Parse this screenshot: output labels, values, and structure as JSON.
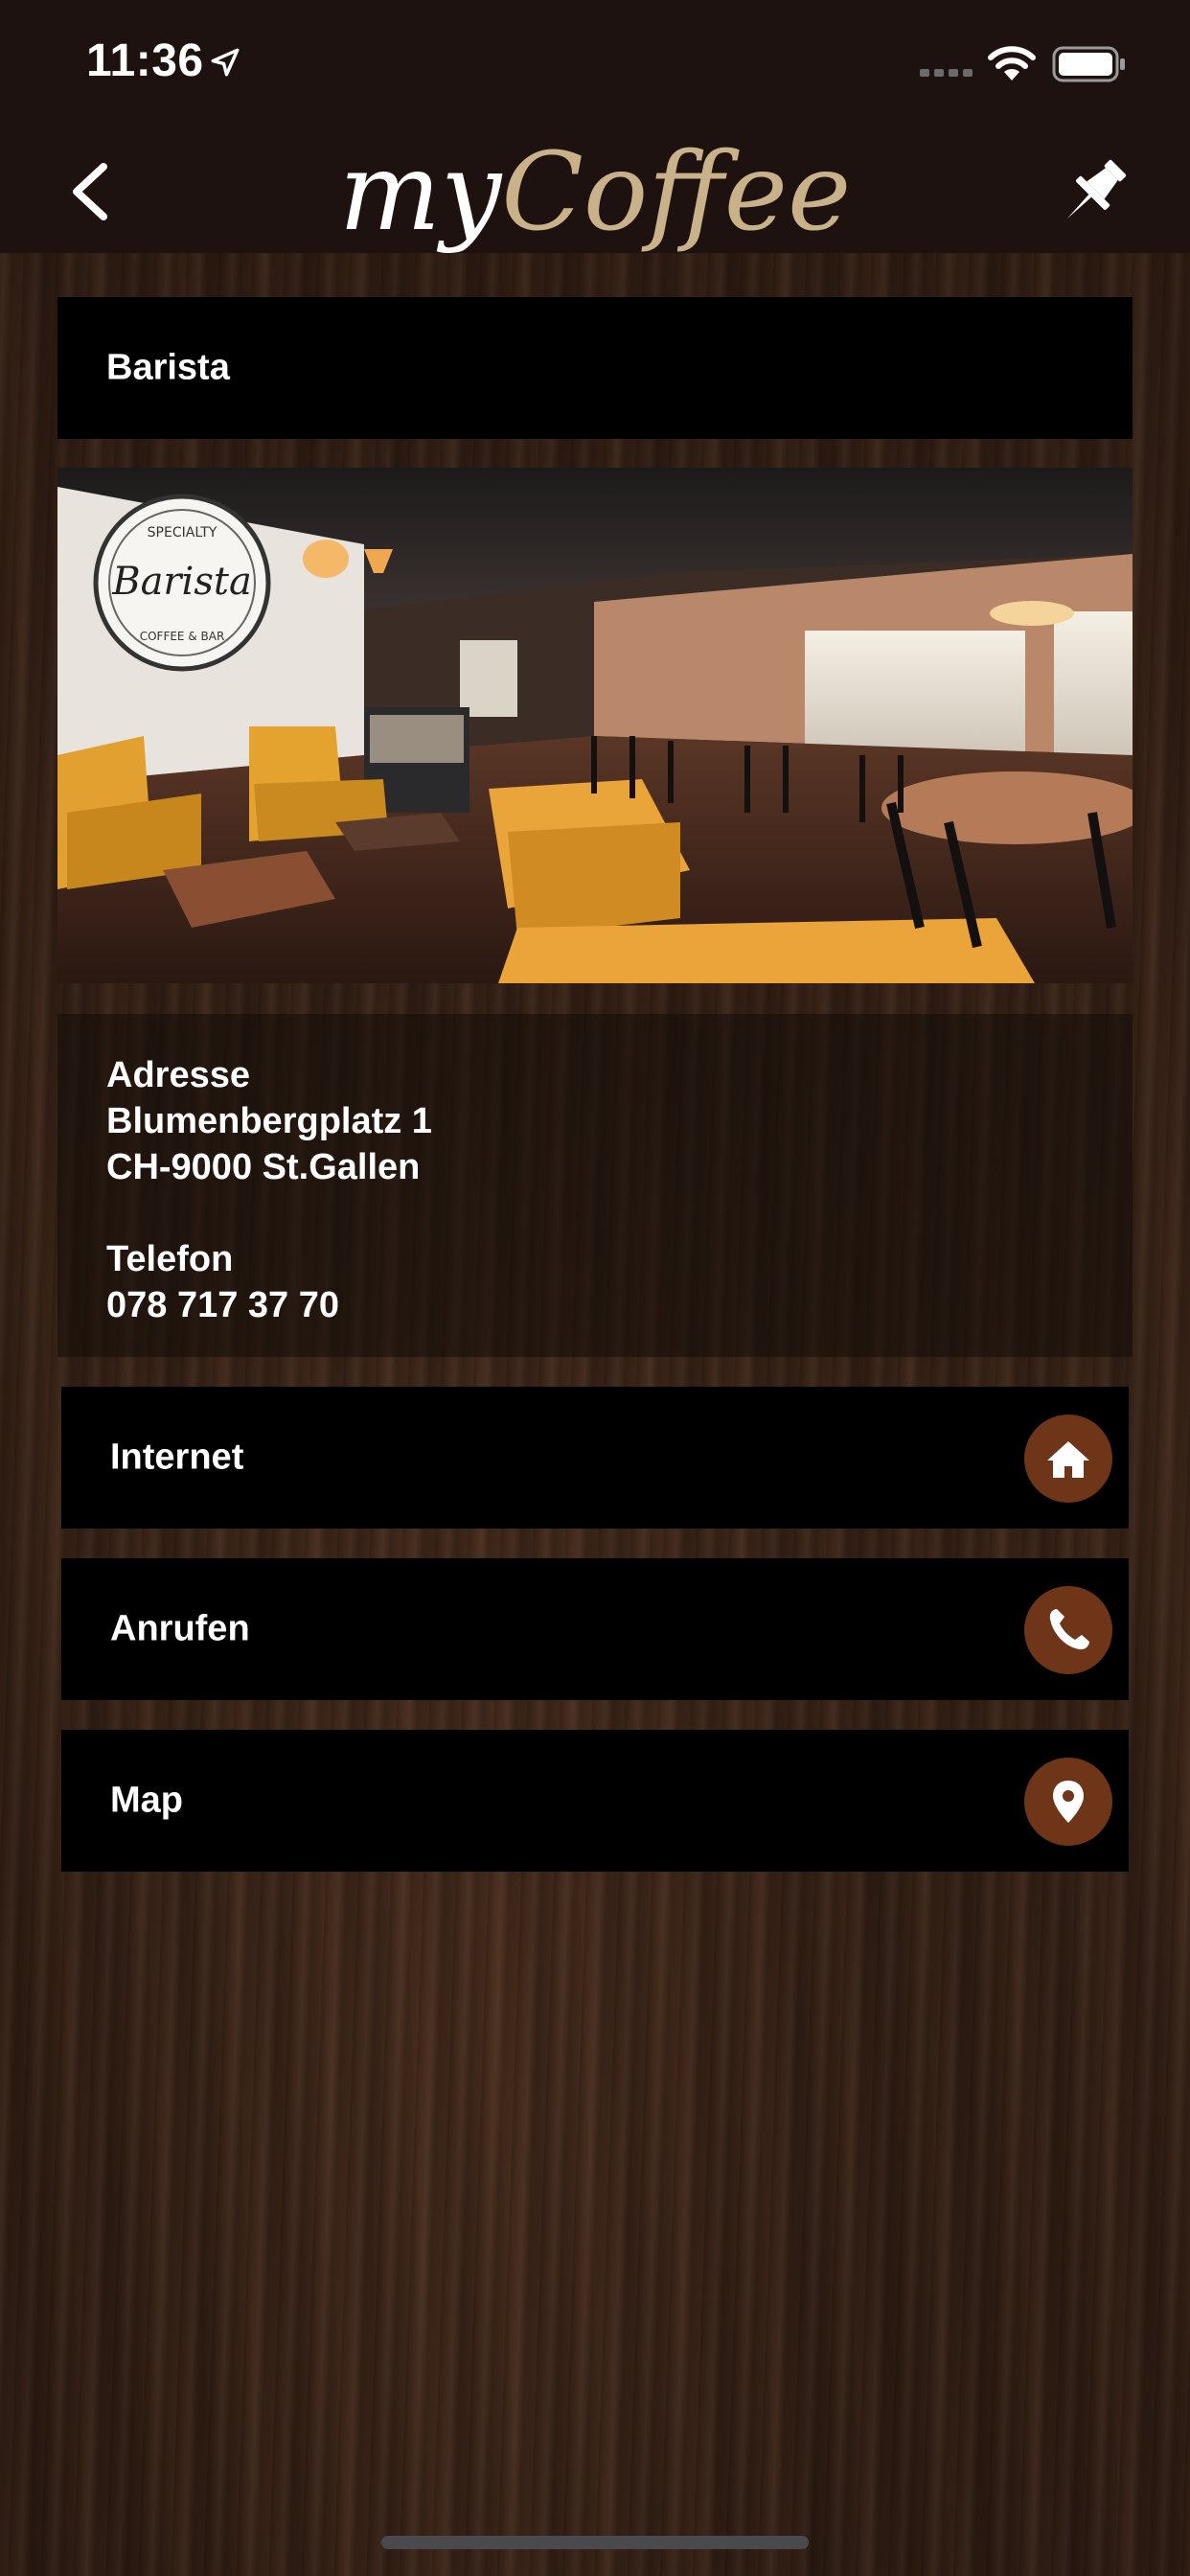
{
  "status_bar": {
    "time": "11:36",
    "icons": [
      "location-arrow-icon",
      "cellular-signal-icon",
      "wifi-icon",
      "battery-icon"
    ]
  },
  "nav": {
    "logo_part1": "my",
    "logo_part2": "Coffee",
    "back_icon": "chevron-left-icon",
    "pin_icon": "pushpin-icon"
  },
  "place": {
    "name": "Barista",
    "photo_logo": {
      "top": "SPECIALTY",
      "middle": "Barista",
      "bottom": "COFFEE & BAR"
    },
    "address_label": "Adresse",
    "address_line1": "Blumenbergplatz 1",
    "address_line2": "CH-9000 St.Gallen",
    "phone_label": "Telefon",
    "phone": "078 717 37 70"
  },
  "actions": [
    {
      "label": "Internet",
      "icon": "home-icon"
    },
    {
      "label": "Anrufen",
      "icon": "phone-icon"
    },
    {
      "label": "Map",
      "icon": "map-pin-icon"
    }
  ],
  "colors": {
    "bar_bg": "#1e1210",
    "logo_accent": "#c9b28a",
    "icon_circle": "#6e3518"
  }
}
